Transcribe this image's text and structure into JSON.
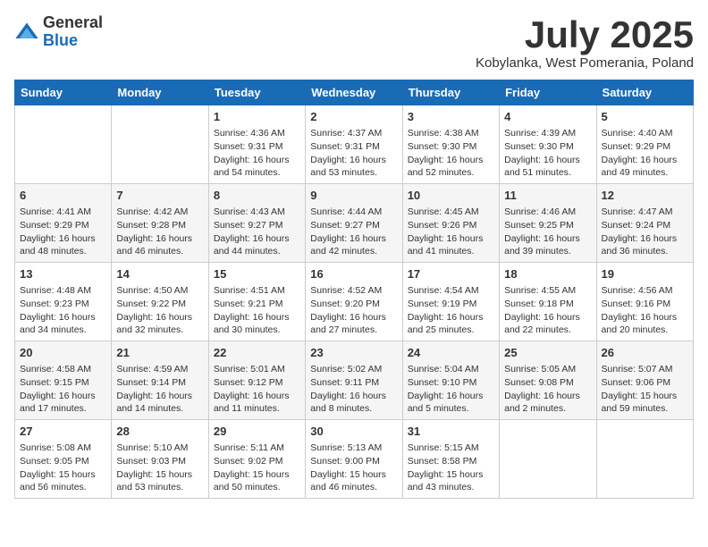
{
  "header": {
    "logo_general": "General",
    "logo_blue": "Blue",
    "title": "July 2025",
    "subtitle": "Kobylanka, West Pomerania, Poland"
  },
  "days_of_week": [
    "Sunday",
    "Monday",
    "Tuesday",
    "Wednesday",
    "Thursday",
    "Friday",
    "Saturday"
  ],
  "weeks": [
    [
      {
        "day": "",
        "info": ""
      },
      {
        "day": "",
        "info": ""
      },
      {
        "day": "1",
        "info": "Sunrise: 4:36 AM\nSunset: 9:31 PM\nDaylight: 16 hours and 54 minutes."
      },
      {
        "day": "2",
        "info": "Sunrise: 4:37 AM\nSunset: 9:31 PM\nDaylight: 16 hours and 53 minutes."
      },
      {
        "day": "3",
        "info": "Sunrise: 4:38 AM\nSunset: 9:30 PM\nDaylight: 16 hours and 52 minutes."
      },
      {
        "day": "4",
        "info": "Sunrise: 4:39 AM\nSunset: 9:30 PM\nDaylight: 16 hours and 51 minutes."
      },
      {
        "day": "5",
        "info": "Sunrise: 4:40 AM\nSunset: 9:29 PM\nDaylight: 16 hours and 49 minutes."
      }
    ],
    [
      {
        "day": "6",
        "info": "Sunrise: 4:41 AM\nSunset: 9:29 PM\nDaylight: 16 hours and 48 minutes."
      },
      {
        "day": "7",
        "info": "Sunrise: 4:42 AM\nSunset: 9:28 PM\nDaylight: 16 hours and 46 minutes."
      },
      {
        "day": "8",
        "info": "Sunrise: 4:43 AM\nSunset: 9:27 PM\nDaylight: 16 hours and 44 minutes."
      },
      {
        "day": "9",
        "info": "Sunrise: 4:44 AM\nSunset: 9:27 PM\nDaylight: 16 hours and 42 minutes."
      },
      {
        "day": "10",
        "info": "Sunrise: 4:45 AM\nSunset: 9:26 PM\nDaylight: 16 hours and 41 minutes."
      },
      {
        "day": "11",
        "info": "Sunrise: 4:46 AM\nSunset: 9:25 PM\nDaylight: 16 hours and 39 minutes."
      },
      {
        "day": "12",
        "info": "Sunrise: 4:47 AM\nSunset: 9:24 PM\nDaylight: 16 hours and 36 minutes."
      }
    ],
    [
      {
        "day": "13",
        "info": "Sunrise: 4:48 AM\nSunset: 9:23 PM\nDaylight: 16 hours and 34 minutes."
      },
      {
        "day": "14",
        "info": "Sunrise: 4:50 AM\nSunset: 9:22 PM\nDaylight: 16 hours and 32 minutes."
      },
      {
        "day": "15",
        "info": "Sunrise: 4:51 AM\nSunset: 9:21 PM\nDaylight: 16 hours and 30 minutes."
      },
      {
        "day": "16",
        "info": "Sunrise: 4:52 AM\nSunset: 9:20 PM\nDaylight: 16 hours and 27 minutes."
      },
      {
        "day": "17",
        "info": "Sunrise: 4:54 AM\nSunset: 9:19 PM\nDaylight: 16 hours and 25 minutes."
      },
      {
        "day": "18",
        "info": "Sunrise: 4:55 AM\nSunset: 9:18 PM\nDaylight: 16 hours and 22 minutes."
      },
      {
        "day": "19",
        "info": "Sunrise: 4:56 AM\nSunset: 9:16 PM\nDaylight: 16 hours and 20 minutes."
      }
    ],
    [
      {
        "day": "20",
        "info": "Sunrise: 4:58 AM\nSunset: 9:15 PM\nDaylight: 16 hours and 17 minutes."
      },
      {
        "day": "21",
        "info": "Sunrise: 4:59 AM\nSunset: 9:14 PM\nDaylight: 16 hours and 14 minutes."
      },
      {
        "day": "22",
        "info": "Sunrise: 5:01 AM\nSunset: 9:12 PM\nDaylight: 16 hours and 11 minutes."
      },
      {
        "day": "23",
        "info": "Sunrise: 5:02 AM\nSunset: 9:11 PM\nDaylight: 16 hours and 8 minutes."
      },
      {
        "day": "24",
        "info": "Sunrise: 5:04 AM\nSunset: 9:10 PM\nDaylight: 16 hours and 5 minutes."
      },
      {
        "day": "25",
        "info": "Sunrise: 5:05 AM\nSunset: 9:08 PM\nDaylight: 16 hours and 2 minutes."
      },
      {
        "day": "26",
        "info": "Sunrise: 5:07 AM\nSunset: 9:06 PM\nDaylight: 15 hours and 59 minutes."
      }
    ],
    [
      {
        "day": "27",
        "info": "Sunrise: 5:08 AM\nSunset: 9:05 PM\nDaylight: 15 hours and 56 minutes."
      },
      {
        "day": "28",
        "info": "Sunrise: 5:10 AM\nSunset: 9:03 PM\nDaylight: 15 hours and 53 minutes."
      },
      {
        "day": "29",
        "info": "Sunrise: 5:11 AM\nSunset: 9:02 PM\nDaylight: 15 hours and 50 minutes."
      },
      {
        "day": "30",
        "info": "Sunrise: 5:13 AM\nSunset: 9:00 PM\nDaylight: 15 hours and 46 minutes."
      },
      {
        "day": "31",
        "info": "Sunrise: 5:15 AM\nSunset: 8:58 PM\nDaylight: 15 hours and 43 minutes."
      },
      {
        "day": "",
        "info": ""
      },
      {
        "day": "",
        "info": ""
      }
    ]
  ]
}
